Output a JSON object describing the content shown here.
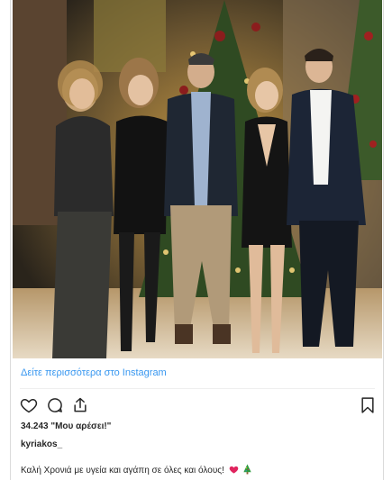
{
  "post": {
    "view_more_label": "Δείτε περισσότερα στο Instagram",
    "likes_text": "34.243 \"Μου αρέσει!\"",
    "username": "kyriakos_",
    "caption_text": "Καλή Χρονιά με υγεία και αγάπη σε όλες και όλους!",
    "caption_emojis": [
      "red-heart",
      "christmas-tree"
    ]
  },
  "icons": {
    "like": "heart-outline-icon",
    "comment": "speech-bubble-icon",
    "share": "share-icon",
    "save": "bookmark-icon"
  },
  "colors": {
    "link": "#3897f0",
    "text": "#262626",
    "heart": "#e0245e",
    "tree": "#2e9b3f"
  }
}
